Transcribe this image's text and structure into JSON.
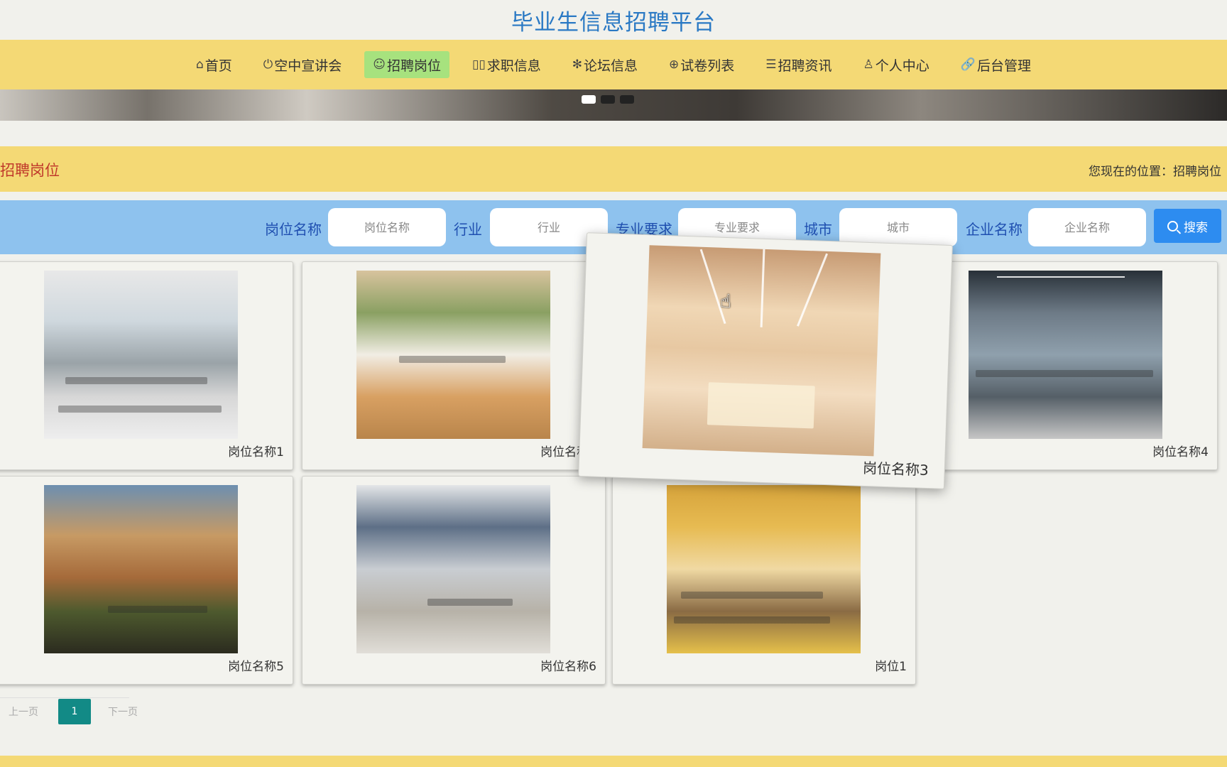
{
  "site": {
    "title": "毕业生信息招聘平台"
  },
  "nav": {
    "items": [
      {
        "icon": "⌂",
        "label": "首页"
      },
      {
        "icon": "⏻",
        "label": "空中宣讲会"
      },
      {
        "icon": "☺",
        "label": "招聘岗位"
      },
      {
        "icon": "▯▯",
        "label": "求职信息"
      },
      {
        "icon": "✻",
        "label": "论坛信息"
      },
      {
        "icon": "⊕",
        "label": "试卷列表"
      },
      {
        "icon": "☰",
        "label": "招聘资讯"
      },
      {
        "icon": "♙",
        "label": "个人中心"
      },
      {
        "icon": "🔗",
        "label": "后台管理"
      }
    ],
    "active_index": 2
  },
  "section": {
    "title": "招聘岗位",
    "breadcrumb": "您现在的位置：招聘岗位"
  },
  "search": {
    "fields": [
      {
        "label": "岗位名称",
        "placeholder": "岗位名称"
      },
      {
        "label": "行业",
        "placeholder": "行业"
      },
      {
        "label": "专业要求",
        "placeholder": "专业要求"
      },
      {
        "label": "城市",
        "placeholder": "城市"
      },
      {
        "label": "企业名称",
        "placeholder": "企业名称"
      }
    ],
    "button_label": "搜索"
  },
  "jobs": [
    {
      "name": "岗位名称1",
      "image_icon": "office-photo-icon"
    },
    {
      "name": "岗位名称2",
      "image_icon": "office-photo-icon"
    },
    {
      "name": "岗位名称3",
      "image_icon": "meeting-room-photo-icon"
    },
    {
      "name": "岗位名称4",
      "image_icon": "office-photo-icon"
    },
    {
      "name": "岗位名称5",
      "image_icon": "restaurant-photo-icon"
    },
    {
      "name": "岗位名称6",
      "image_icon": "office-photo-icon"
    },
    {
      "name": "岗位1",
      "image_icon": "office-photo-icon"
    }
  ],
  "pagination": {
    "prev": "上一页",
    "current": "1",
    "next": "下一页"
  },
  "colors": {
    "nav_bg": "#f4d975",
    "nav_active": "#a7e27e",
    "search_bg": "#8ec2ee",
    "search_button": "#2d8cf0",
    "title_blue": "#2a79c4",
    "section_red": "#c0392b",
    "page_active": "#128a86"
  }
}
